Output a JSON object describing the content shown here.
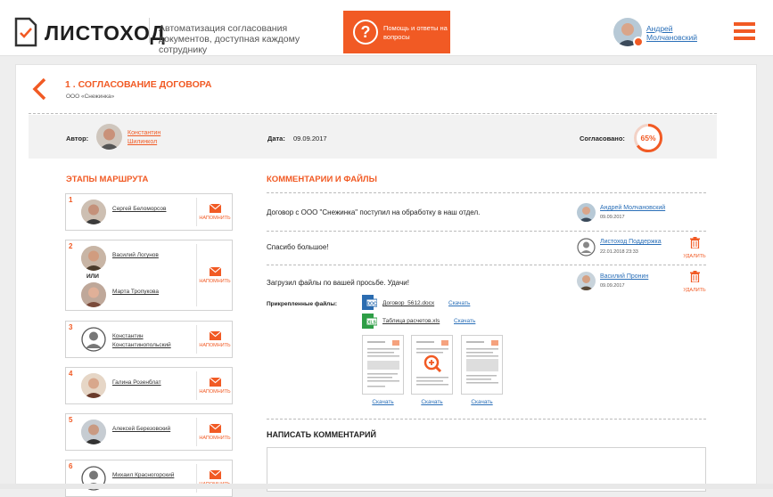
{
  "header": {
    "logo_text": "ЛИСТОХОД",
    "tagline": "Автоматизация согласования документов, доступная каждому сотруднику",
    "help_label": "Помощь и ответы на вопросы",
    "help_icon": "question-icon",
    "user_name": "Андрей Молчановский",
    "menu_icon": "hamburger-icon"
  },
  "document": {
    "title": "1 . СОГЛАСОВАНИЕ ДОГОВОРА",
    "org": "ООО «Снежинка»",
    "author_label": "Автор:",
    "author_name": "Константин Шилинкол",
    "date_label": "Дата:",
    "date_value": "09.09.2017",
    "approved_label": "Согласовано:",
    "approved_percent": "65%",
    "approved_fraction": 0.65
  },
  "stages": {
    "title": "ЭТАПЫ МАРШРУТА",
    "remind_label": "НАПОМНИТЬ",
    "or_label": "ИЛИ",
    "items": [
      {
        "num": "1",
        "people": [
          "Сергей Беломорсов"
        ]
      },
      {
        "num": "2",
        "people": [
          "Василий Логунов",
          "Марта Тропукова"
        ]
      },
      {
        "num": "3",
        "people": [
          "Константин Константинопольский"
        ]
      },
      {
        "num": "4",
        "people": [
          "Галина Розенблат"
        ]
      },
      {
        "num": "5",
        "people": [
          "Алексей Березовский"
        ]
      },
      {
        "num": "6",
        "people": [
          "Михаил Красногорский"
        ]
      }
    ]
  },
  "comments": {
    "title": "КОММЕНТАРИИ И ФАЙЛЫ",
    "delete_label": "УДАЛИТЬ",
    "items": [
      {
        "text": "Договор с ООО \"Снежинка\" поступил на обработку в наш отдел.",
        "author": "Андрей Молчановский",
        "date": "09.09.2017"
      },
      {
        "text": "Спасибо большое!",
        "author": "Листоход Поддержка",
        "date": "22.01.2018 23:33"
      },
      {
        "text": "Загрузил файлы по вашей просьбе. Удачи!",
        "author": "Василий Пронин",
        "date": "09.09.2017"
      }
    ],
    "attached_label": "Прикрепленные файлы:",
    "files": [
      {
        "name": "Договор_5612.docx",
        "ext": "DOC",
        "color": "#2b6cb0"
      },
      {
        "name": "Таблица расчетов.xls",
        "ext": "XLS",
        "color": "#2e9e46"
      }
    ],
    "download_label": "Скачать"
  },
  "write_comment": {
    "title": "НАПИСАТЬ КОММЕНТАРИЙ"
  },
  "colors": {
    "accent": "#f15a24",
    "link": "#2a6fb8"
  }
}
